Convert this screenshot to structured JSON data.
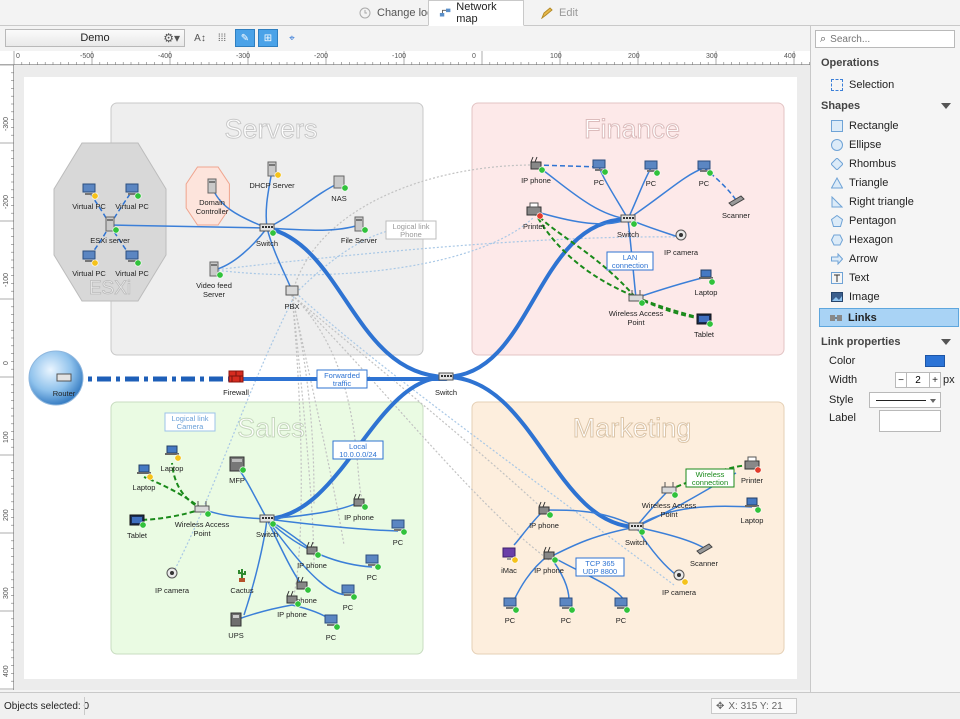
{
  "tabs": [
    {
      "label": "Change log",
      "active": false
    },
    {
      "label": "Network map",
      "active": true
    },
    {
      "label": "Edit",
      "active": false
    }
  ],
  "toolbar": {
    "document": "Demo"
  },
  "ruler": {
    "top_ticks": [
      "0",
      "-500",
      "-400",
      "-300",
      "-200",
      "-100",
      "0",
      "100",
      "200",
      "300",
      "400"
    ],
    "left_ticks": [
      "-300",
      "-200",
      "-100",
      "0",
      "100",
      "200",
      "300",
      "400"
    ]
  },
  "search": {
    "placeholder": "Search..."
  },
  "sidebar": {
    "operations_title": "Operations",
    "selection": "Selection",
    "shapes_title": "Shapes",
    "shapes": [
      "Rectangle",
      "Ellipse",
      "Rhombus",
      "Triangle",
      "Right triangle",
      "Pentagon",
      "Hexagon",
      "Arrow",
      "Text",
      "Image"
    ],
    "links": "Links",
    "link_props_title": "Link properties",
    "color_label": "Color",
    "color_value": "#2b73d6",
    "width_label": "Width",
    "width_value": "2",
    "width_unit": "px",
    "style_label": "Style",
    "label_label": "Label"
  },
  "status": {
    "selected": "Objects selected: 0",
    "coords": "X: 315 Y: 21"
  },
  "map": {
    "groups": {
      "servers": "Servers",
      "finance": "Finance",
      "sales": "Sales",
      "marketing": "Marketing",
      "esxi": "ESXi"
    },
    "devices": {
      "virtual_pc": "Virtual PC",
      "esxi_server": "ESXi server",
      "domain_controller_1": "Domain",
      "domain_controller_2": "Controller",
      "dhcp": "DHCP Server",
      "nas": "NAS",
      "file_server": "File Server",
      "switch": "Switch",
      "video_1": "Video feed",
      "video_2": "Server",
      "pbx": "PBX",
      "router": "Router",
      "firewall": "Firewall",
      "ip_phone": "IP phone",
      "pc": "PC",
      "printer": "Printer",
      "scanner": "Scanner",
      "ip_camera": "IP camera",
      "wap_1": "Wireless Access",
      "wap_2": "Point",
      "laptop": "Laptop",
      "tablet": "Tablet",
      "mfp": "MFP",
      "cactus": "Cactus",
      "ups": "UPS",
      "imac": "iMac"
    },
    "link_labels": {
      "logical_phone_1": "Logical link",
      "logical_phone_2": "Phone",
      "logical_camera_1": "Logical link",
      "logical_camera_2": "Camera",
      "lan_1": "LAN",
      "lan_2": "connection",
      "forwarded_1": "Forwarded",
      "forwarded_2": "traffic",
      "local_1": "Local",
      "local_2": "10.0.0.0/24",
      "tcp_1": "TCP 365",
      "tcp_2": "UDP 8800",
      "wireless_1": "Wireless",
      "wireless_2": "connection"
    }
  }
}
